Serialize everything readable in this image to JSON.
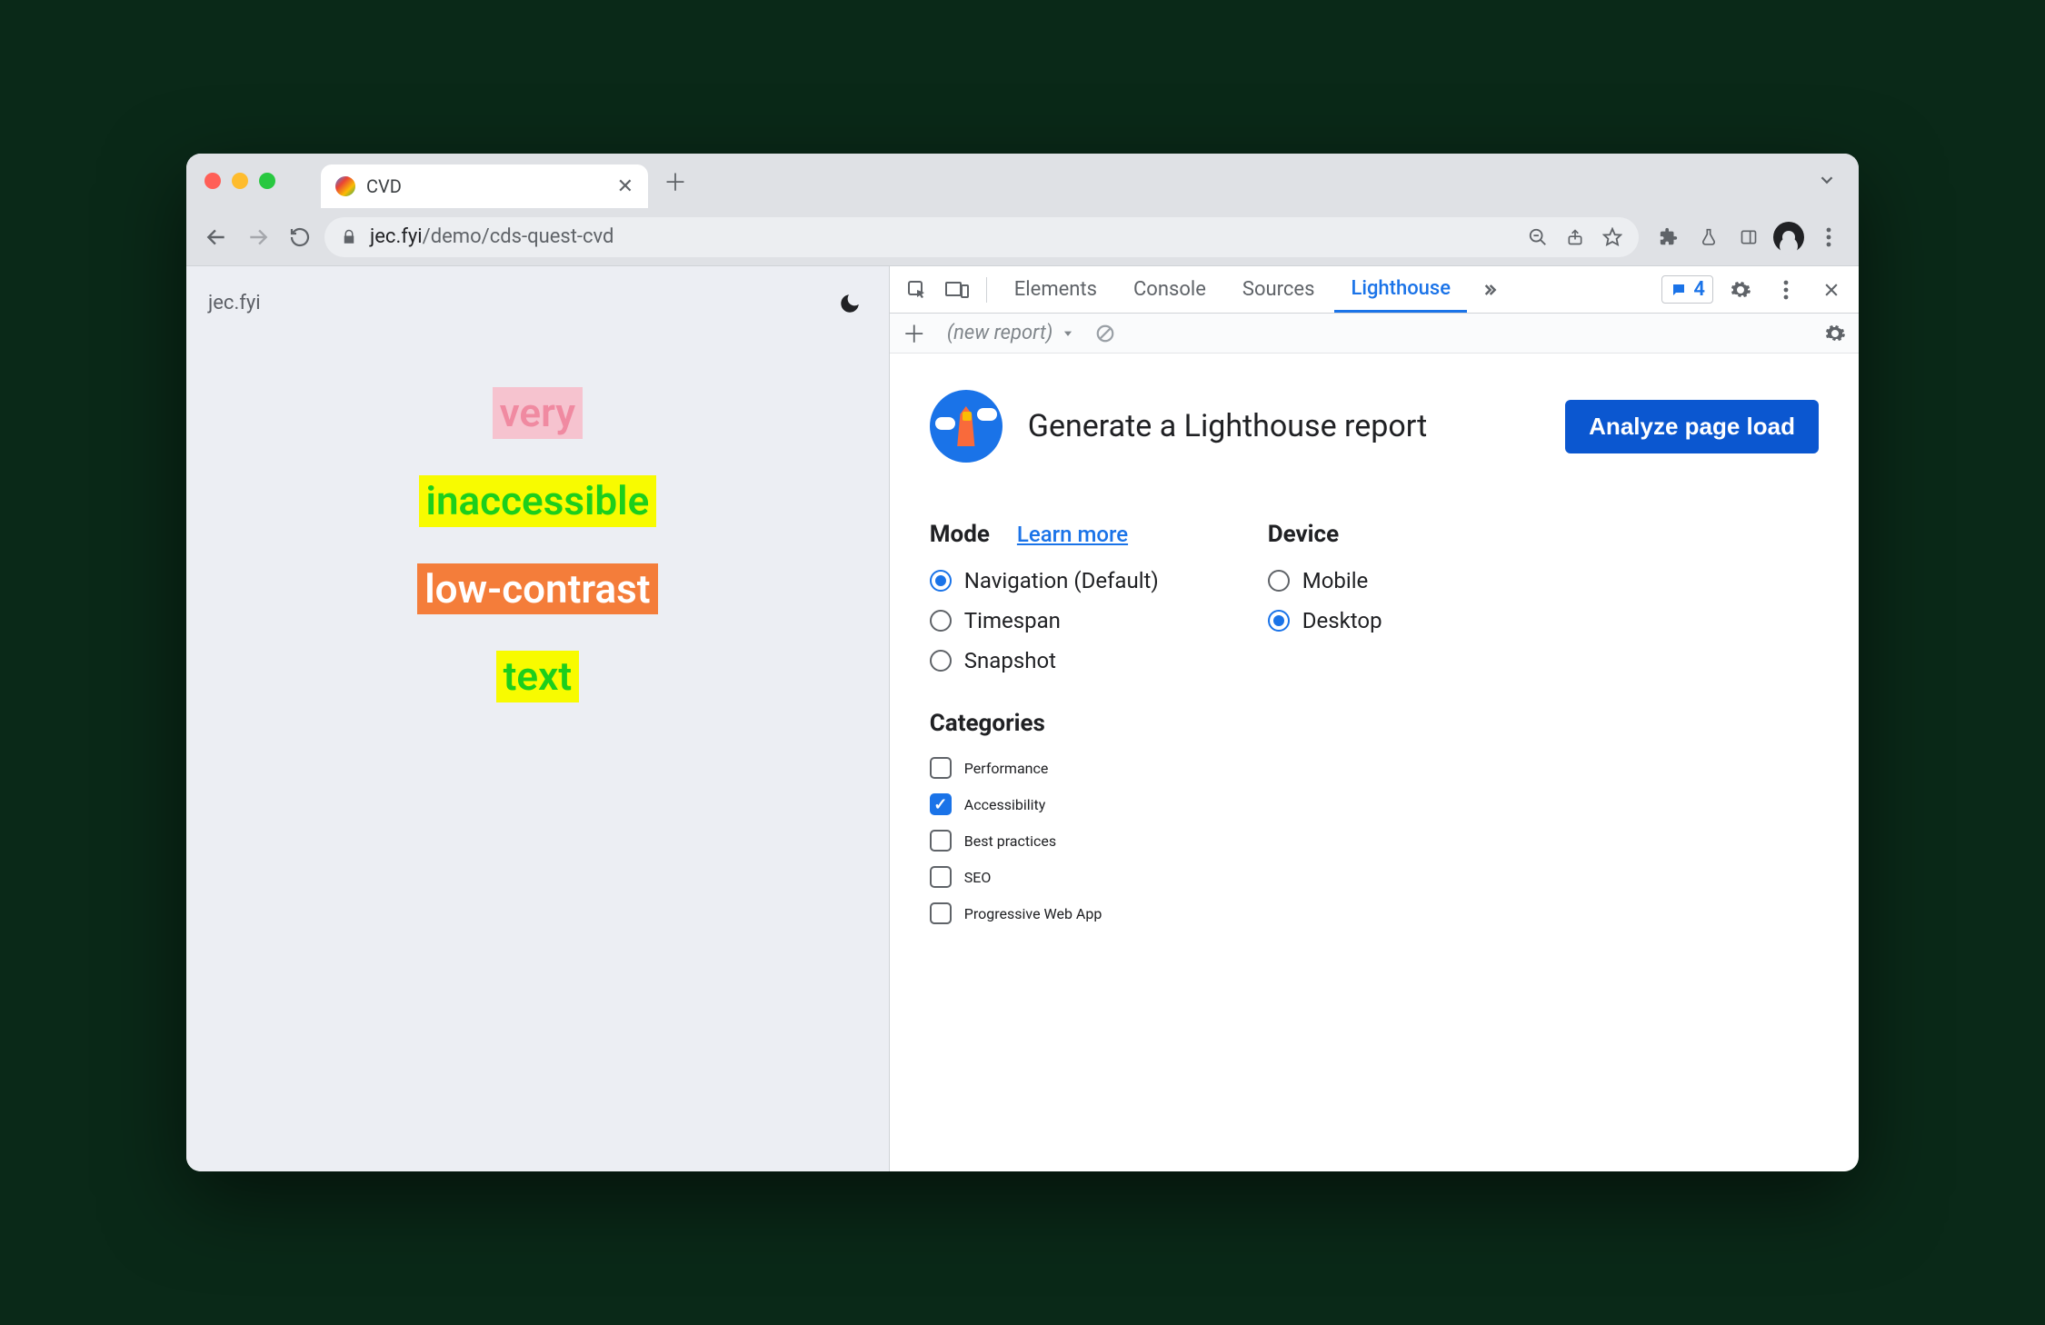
{
  "browser": {
    "tab_title": "CVD",
    "url_host": "jec.fyi",
    "url_path": "/demo/cds-quest-cvd"
  },
  "page": {
    "brand": "jec.fyi",
    "words": [
      "very",
      "inaccessible",
      "low-contrast",
      "text"
    ]
  },
  "devtools": {
    "tabs": [
      "Elements",
      "Console",
      "Sources",
      "Lighthouse"
    ],
    "active_tab": "Lighthouse",
    "issues_count": "4",
    "subbar": {
      "new_report": "(new report)"
    }
  },
  "lighthouse": {
    "heading": "Generate a Lighthouse report",
    "analyze_label": "Analyze page load",
    "mode": {
      "label": "Mode",
      "learn_more": "Learn more",
      "options": [
        "Navigation (Default)",
        "Timespan",
        "Snapshot"
      ],
      "selected": "Navigation (Default)"
    },
    "device": {
      "label": "Device",
      "options": [
        "Mobile",
        "Desktop"
      ],
      "selected": "Desktop"
    },
    "categories": {
      "label": "Categories",
      "options": [
        "Performance",
        "Accessibility",
        "Best practices",
        "SEO",
        "Progressive Web App"
      ],
      "checked": [
        "Accessibility"
      ]
    }
  }
}
